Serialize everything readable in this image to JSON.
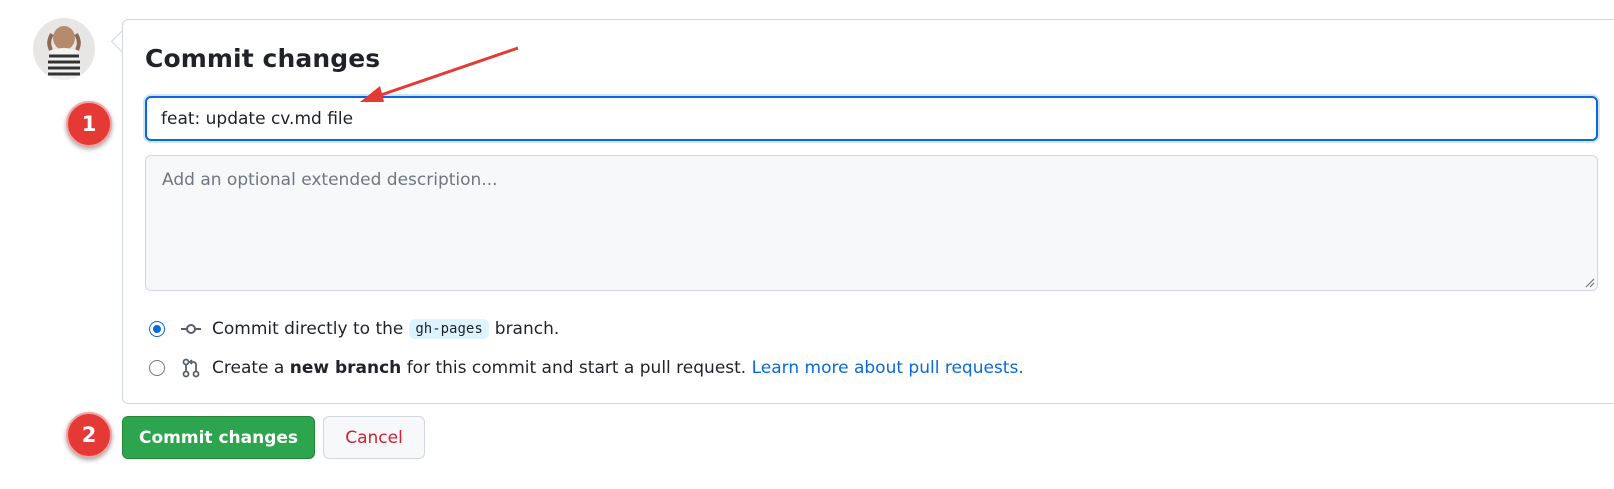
{
  "commit_form": {
    "title": "Commit changes",
    "summary_value": "feat: update cv.md file",
    "description_placeholder": "Add an optional extended description...",
    "option_direct": {
      "prefix": "Commit directly to the",
      "branch": "gh-pages",
      "suffix": "branch.",
      "selected": true
    },
    "option_new_branch": {
      "prefix": "Create a",
      "bold": "new branch",
      "middle": "for this commit and start a pull request.",
      "link": "Learn more about pull requests.",
      "selected": false
    }
  },
  "actions": {
    "commit_label": "Commit changes",
    "cancel_label": "Cancel"
  },
  "annotations": {
    "marker_1": "1",
    "marker_2": "2"
  },
  "icons": {
    "avatar": "avatar",
    "commit_icon": "git-commit-icon",
    "pr_icon": "git-pull-request-icon"
  },
  "colors": {
    "accent_blue": "#0969da",
    "primary_green": "#2da44e",
    "danger_red": "#cf222e",
    "annotation_red": "#e53935"
  }
}
